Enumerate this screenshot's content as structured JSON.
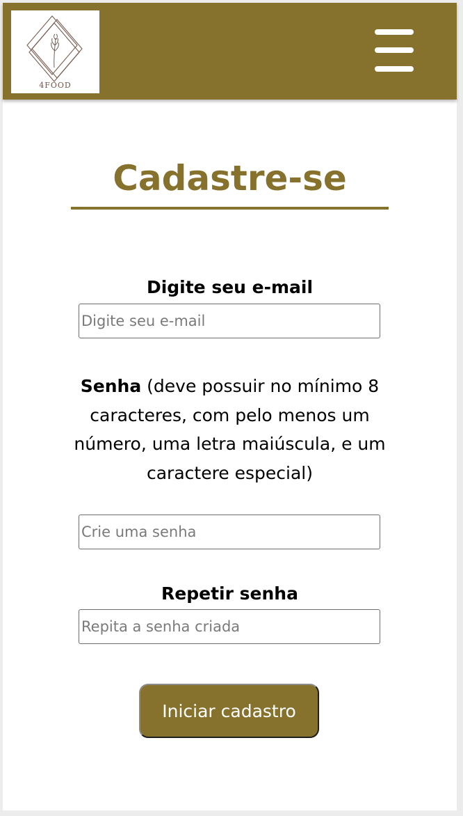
{
  "header": {
    "logo_text": "4FOOD",
    "menu_icon": "hamburger-menu-icon",
    "background_color": "#87722d"
  },
  "page": {
    "title": "Cadastre-se",
    "accent_color": "#87722d"
  },
  "form": {
    "email": {
      "label": "Digite seu e-mail",
      "placeholder": "Digite seu e-mail",
      "value": ""
    },
    "password": {
      "label_bold": "Senha",
      "label_hint": " (deve possuir no mínimo 8 caracteres, com pelo menos um número, uma letra maiúscula, e um caractere especial)",
      "placeholder": "Crie uma senha",
      "value": ""
    },
    "repeat_password": {
      "label": "Repetir senha",
      "placeholder": "Repita a senha criada",
      "value": ""
    },
    "submit_label": "Iniciar cadastro"
  }
}
